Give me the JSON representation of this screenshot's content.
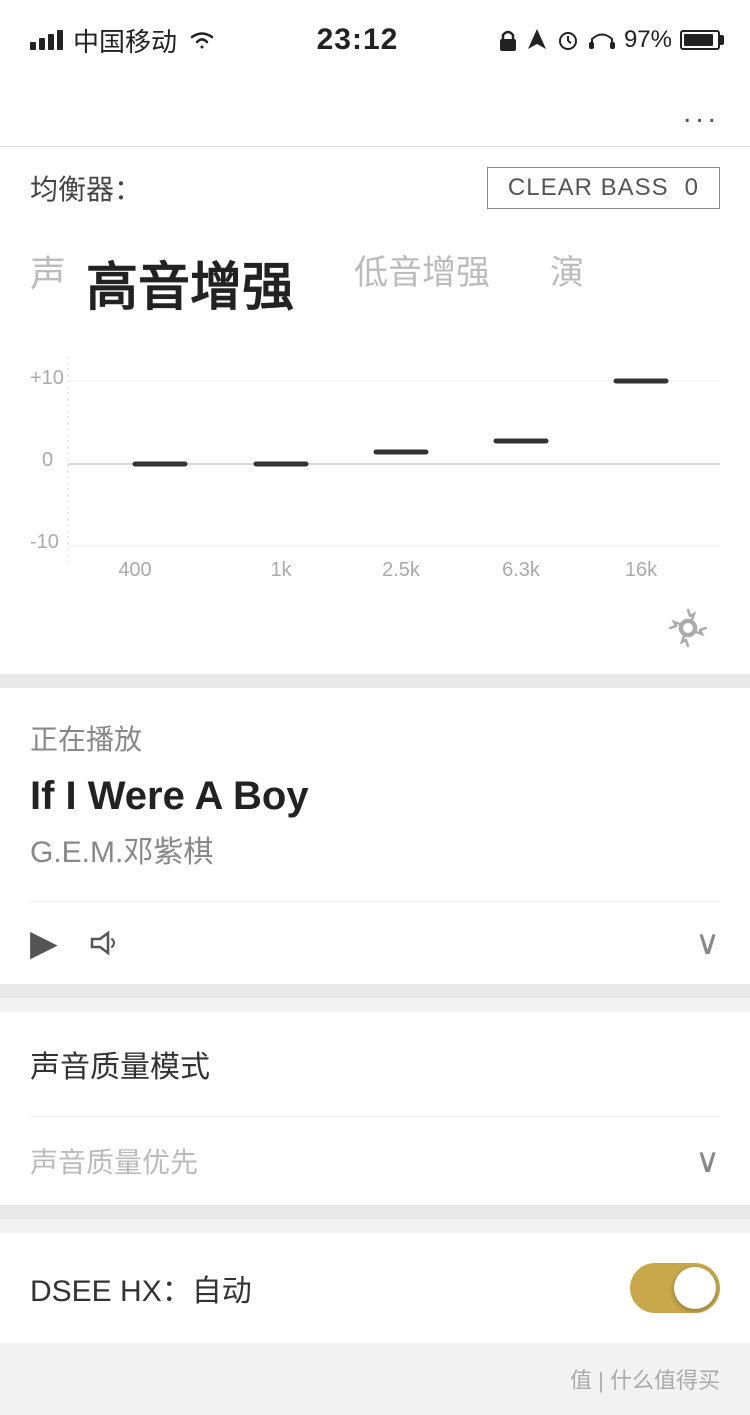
{
  "status_bar": {
    "carrier": "中国移动",
    "time": "23:12",
    "battery_percent": "97%"
  },
  "more_menu": "...",
  "equalizer": {
    "label": "均衡器：",
    "clear_bass_label": "CLEAR BASS",
    "clear_bass_value": "0",
    "tabs": [
      {
        "id": "tab-voice",
        "label": "声",
        "state": "left-partial"
      },
      {
        "id": "tab-treble",
        "label": "高音增强",
        "state": "active"
      },
      {
        "id": "tab-bass",
        "label": "低音增强",
        "state": "inactive"
      },
      {
        "id": "tab-stage",
        "label": "演",
        "state": "right-partial"
      }
    ],
    "chart": {
      "x_labels": [
        "400",
        "1k",
        "2.5k",
        "6.3k",
        "16k"
      ],
      "y_labels": [
        "+10",
        "0",
        "-10"
      ],
      "bars": [
        {
          "freq": "400",
          "value": 0
        },
        {
          "freq": "1k",
          "value": 0
        },
        {
          "freq": "2.5k",
          "value": 1
        },
        {
          "freq": "6.3k",
          "value": 2
        },
        {
          "freq": "16k",
          "value": 10
        }
      ]
    }
  },
  "now_playing": {
    "section_label": "正在播放",
    "track_name": "If I Were A Boy",
    "artist_name": "G.E.M.邓紫棋"
  },
  "sound_quality": {
    "section_title": "声音质量模式",
    "dropdown_label": "声音质量优先"
  },
  "dsee": {
    "label": "DSEE HX：自动",
    "enabled": true
  },
  "bottom_hint": "值 | 什么值得买"
}
